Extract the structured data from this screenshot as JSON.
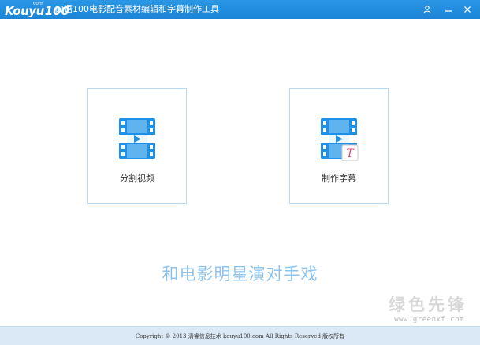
{
  "titlebar": {
    "logo_word": "Kouyu",
    "logo_num": "100",
    "logo_com": "com",
    "title": "口语100电影配音素材编辑和字幕制作工具"
  },
  "cards": {
    "split": {
      "label": "分割视频",
      "icon": "film-icon"
    },
    "subtitle": {
      "label": "制作字幕",
      "icon": "film-subtitle-icon"
    }
  },
  "slogan": "和电影明星演对手戏",
  "watermark": {
    "text": "绿色先锋",
    "url": "www.greenxf.com"
  },
  "footer": {
    "copyright": "Copyright © 2013 清睿信息技术 kouyu100.com All Rights Reserved 版权所有"
  },
  "colors": {
    "titlebar": "#1b84d6",
    "card_border": "#b7d9f2",
    "icon_blue": "#1e90e6",
    "slogan": "#8cc3ec",
    "footer": "#dbe9f6"
  }
}
